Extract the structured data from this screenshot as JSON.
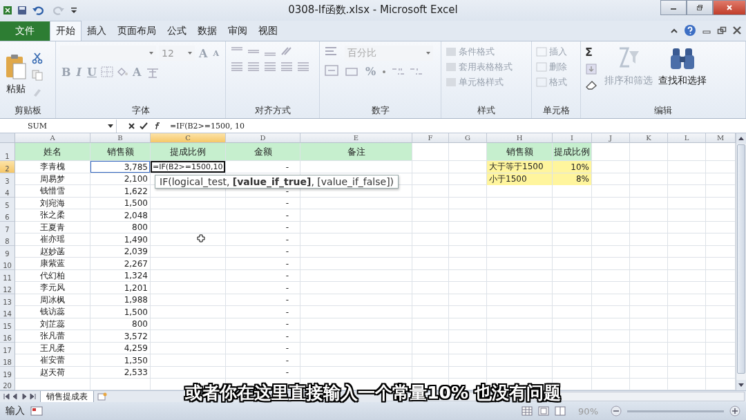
{
  "window": {
    "title": "0308-If函数.xlsx - Microsoft Excel"
  },
  "file_tab": "文件",
  "tabs": [
    {
      "label": "开始",
      "selected": true
    },
    {
      "label": "插入",
      "selected": false
    },
    {
      "label": "页面布局",
      "selected": false
    },
    {
      "label": "公式",
      "selected": false
    },
    {
      "label": "数据",
      "selected": false
    },
    {
      "label": "审阅",
      "selected": false
    },
    {
      "label": "视图",
      "selected": false
    }
  ],
  "ribbon": {
    "clipboard": {
      "label": "剪贴板",
      "paste": "粘贴"
    },
    "font": {
      "label": "字体",
      "size": "12",
      "grow": "A",
      "shrink": "A",
      "styles": [
        "B",
        "I",
        "U"
      ],
      "color_button": "A"
    },
    "alignment": {
      "label": "对齐方式"
    },
    "number": {
      "label": "数字",
      "format": "百分比",
      "percent": "%"
    },
    "styles": {
      "label": "样式",
      "items": [
        "条件格式",
        "套用表格格式",
        "单元格样式"
      ]
    },
    "cells": {
      "label": "单元格",
      "items": [
        "插入",
        "删除",
        "格式"
      ]
    },
    "editing": {
      "label": "编辑",
      "sum": "Σ",
      "sort": "排序和筛选",
      "find": "查找和选择"
    }
  },
  "formula_bar": {
    "name_box": "SUM",
    "formula": "=IF(B2>=1500, 10"
  },
  "columns": [
    {
      "label": "A",
      "selected": false
    },
    {
      "label": "B",
      "selected": false
    },
    {
      "label": "C",
      "selected": true
    },
    {
      "label": "D",
      "selected": false
    },
    {
      "label": "E",
      "selected": false
    },
    {
      "label": "F",
      "selected": false
    },
    {
      "label": "G",
      "selected": false
    },
    {
      "label": "H",
      "selected": false
    },
    {
      "label": "I",
      "selected": false
    },
    {
      "label": "J",
      "selected": false
    },
    {
      "label": "K",
      "selected": false
    },
    {
      "label": "L",
      "selected": false
    },
    {
      "label": "M",
      "selected": false
    }
  ],
  "row_headers": [
    {
      "label": "1",
      "selected": false
    },
    {
      "label": "2",
      "selected": true
    },
    {
      "label": "3",
      "selected": false
    },
    {
      "label": "4",
      "selected": false
    },
    {
      "label": "5",
      "selected": false
    },
    {
      "label": "6",
      "selected": false
    },
    {
      "label": "7",
      "selected": false
    },
    {
      "label": "8",
      "selected": false
    },
    {
      "label": "9",
      "selected": false
    },
    {
      "label": "10",
      "selected": false
    },
    {
      "label": "11",
      "selected": false
    },
    {
      "label": "12",
      "selected": false
    },
    {
      "label": "13",
      "selected": false
    },
    {
      "label": "14",
      "selected": false
    },
    {
      "label": "15",
      "selected": false
    },
    {
      "label": "16",
      "selected": false
    },
    {
      "label": "17",
      "selected": false
    },
    {
      "label": "18",
      "selected": false
    },
    {
      "label": "19",
      "selected": false
    },
    {
      "label": "20",
      "selected": false
    }
  ],
  "sheet": {
    "header": [
      "姓名",
      "销售额",
      "提成比例",
      "金额",
      "备注"
    ],
    "rows": [
      {
        "name": "李青槐",
        "sales": "3,785",
        "amount": "-",
        "formula": "=IF(B2>=1500,10"
      },
      {
        "name": "周易梦",
        "sales": "2,100"
      },
      {
        "name": "钱惜雪",
        "sales": "1,622",
        "amount": "-"
      },
      {
        "name": "刘宛海",
        "sales": "1,500",
        "amount": "-"
      },
      {
        "name": "张之柔",
        "sales": "2,048",
        "amount": "-"
      },
      {
        "name": "王夏青",
        "sales": "800",
        "amount": "-"
      },
      {
        "name": "崔亦瑶",
        "sales": "1,490",
        "amount": "-"
      },
      {
        "name": "赵妙菡",
        "sales": "2,039",
        "amount": "-"
      },
      {
        "name": "康紫蓝",
        "sales": "2,267",
        "amount": "-"
      },
      {
        "name": "代幻柏",
        "sales": "1,324",
        "amount": "-"
      },
      {
        "name": "李元风",
        "sales": "1,201",
        "amount": "-"
      },
      {
        "name": "周冰枫",
        "sales": "1,988",
        "amount": "-"
      },
      {
        "name": "钱访蕊",
        "sales": "1,500",
        "amount": "-"
      },
      {
        "name": "刘芷蕊",
        "sales": "800",
        "amount": "-"
      },
      {
        "name": "张凡蕾",
        "sales": "3,572",
        "amount": "-"
      },
      {
        "name": "王凡柔",
        "sales": "4,259",
        "amount": "-"
      },
      {
        "name": "崔安蕾",
        "sales": "1,350",
        "amount": "-"
      },
      {
        "name": "赵天荷",
        "sales": "2,533",
        "amount": "-"
      }
    ],
    "tooltip": "IF(logical_test, **[value_if_true]**, [value_if_false])"
  },
  "lookup": {
    "header": [
      "销售额",
      "提成比例"
    ],
    "rows": [
      [
        "大于等于1500",
        "10%"
      ],
      [
        "小于1500",
        "8%"
      ]
    ]
  },
  "sheet_tabs": [
    {
      "label": "销售提成表",
      "selected": true
    }
  ],
  "status_bar": {
    "mode": "输入",
    "zoom": "90%"
  },
  "subtitle": "或者你在这里直接输入一个常量10%  也没有问题"
}
